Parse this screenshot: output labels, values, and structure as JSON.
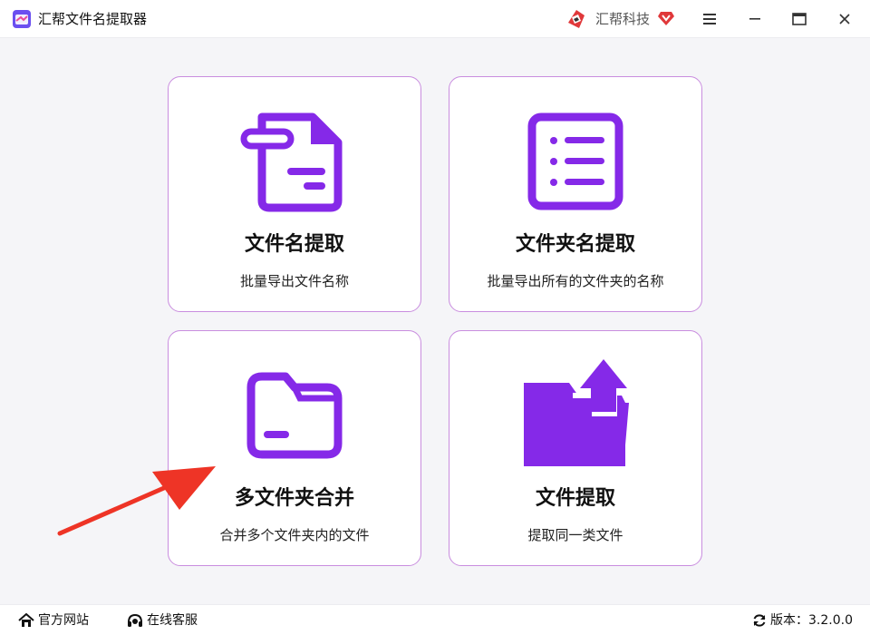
{
  "window": {
    "title": "汇帮文件名提取器",
    "brand": "汇帮科技"
  },
  "colors": {
    "accent": "#8529e8",
    "card_border": "#c98ddf",
    "arrow": "#ee3426",
    "brand_red": "#e0383a"
  },
  "cards": [
    {
      "title": "文件名提取",
      "desc": "批量导出文件名称",
      "icon": "document-icon"
    },
    {
      "title": "文件夹名提取",
      "desc": "批量导出所有的文件夹的名称",
      "icon": "list-icon"
    },
    {
      "title": "多文件夹合并",
      "desc": "合并多个文件夹内的文件",
      "icon": "folder-icon"
    },
    {
      "title": "文件提取",
      "desc": "提取同一类文件",
      "icon": "folder-upload-icon"
    }
  ],
  "footer": {
    "website": "官方网站",
    "service": "在线客服",
    "version_label": "版本：",
    "version": "3.2.0.0"
  }
}
